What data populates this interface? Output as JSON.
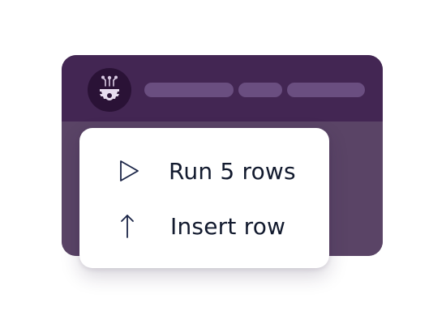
{
  "colors": {
    "window_header": "#432653",
    "window_body": "#5a4466",
    "logo_bg": "#2a1236",
    "placeholder_pill": "#6a4e80",
    "menu_bg": "#ffffff",
    "menu_text": "#121a2e",
    "icon_stroke": "#1b2547"
  },
  "header": {
    "logo_icon": "gear-chip-icon",
    "placeholders": [
      "title-placeholder",
      "tab-placeholder",
      "tab-placeholder"
    ]
  },
  "menu": {
    "items": [
      {
        "icon": "play-icon",
        "label": "Run 5 rows"
      },
      {
        "icon": "arrow-up-icon",
        "label": "Insert row"
      }
    ]
  }
}
